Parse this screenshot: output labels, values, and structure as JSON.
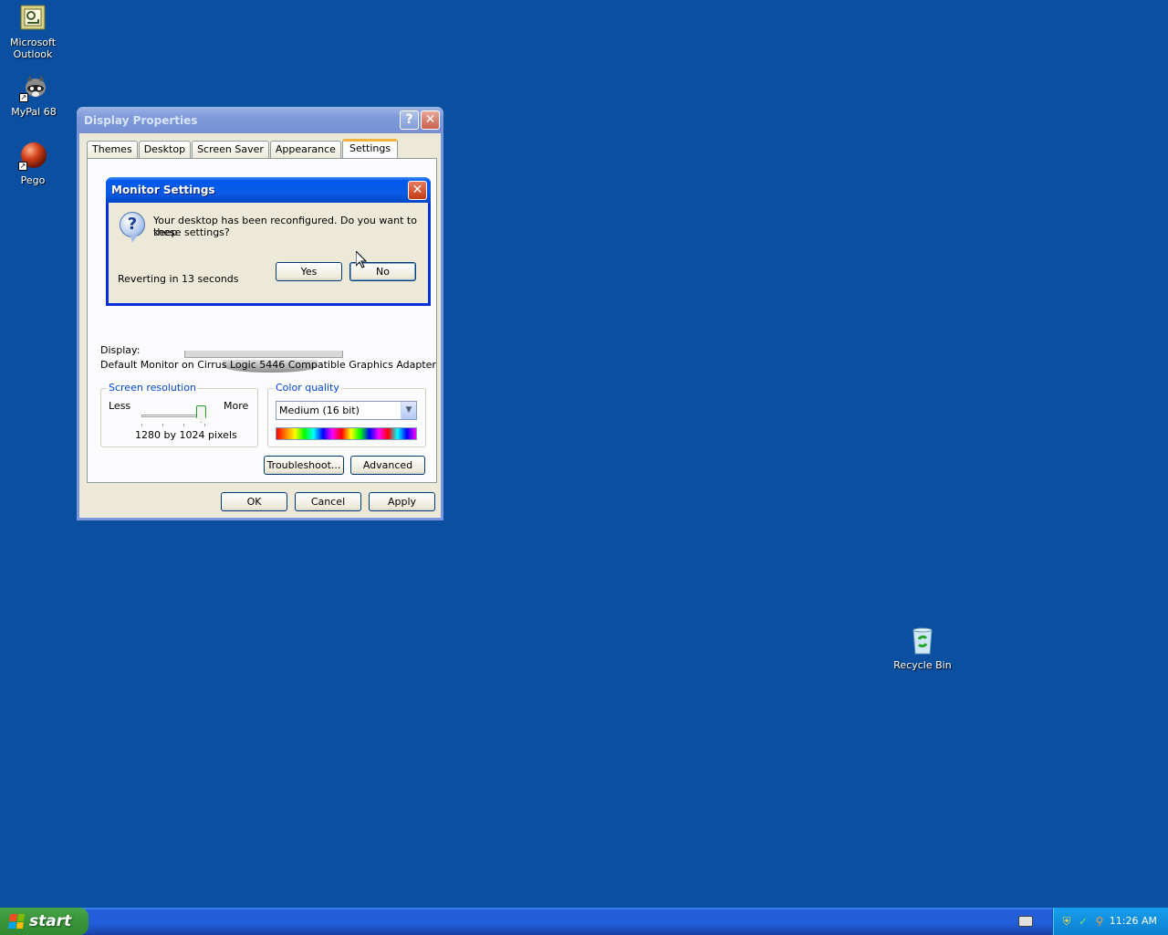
{
  "desktop": {
    "icons": [
      {
        "label_line1": "Microsoft",
        "label_line2": "Outlook"
      },
      {
        "label_line1": "MyPal 68",
        "label_line2": ""
      },
      {
        "label_line1": "Pego",
        "label_line2": ""
      },
      {
        "label_line1": "Recycle Bin",
        "label_line2": ""
      }
    ]
  },
  "display_properties": {
    "title": "Display Properties",
    "help_glyph": "?",
    "close_glyph": "✕",
    "tabs": [
      "Themes",
      "Desktop",
      "Screen Saver",
      "Appearance",
      "Settings"
    ],
    "active_tab": "Settings",
    "display_label": "Display:",
    "display_value": "Default Monitor on Cirrus Logic 5446 Compatible Graphics Adapter",
    "screen_resolution": {
      "legend": "Screen resolution",
      "less": "Less",
      "more": "More",
      "value_text": "1280 by 1024 pixels",
      "slider_level": 1.0
    },
    "color_quality": {
      "legend": "Color quality",
      "selected": "Medium (16 bit)"
    },
    "buttons": {
      "troubleshoot": "Troubleshoot...",
      "advanced": "Advanced",
      "ok": "OK",
      "cancel": "Cancel",
      "apply": "Apply"
    }
  },
  "monitor_settings": {
    "title": "Monitor Settings",
    "close_glyph": "✕",
    "message_line1": "Your desktop has been reconfigured.  Do you want to keep",
    "message_line2": "these settings?",
    "countdown": "Reverting in 13 seconds",
    "yes": "Yes",
    "no": "No"
  },
  "taskbar": {
    "start_label": "start",
    "clock": "11:26 AM"
  },
  "colors": {
    "desktop": "#0a4fa0",
    "titlebar_active": "#0058ee",
    "titlebar_inactive": "#7f9ad9",
    "taskbar": "#245edb",
    "start_button": "#3b963c"
  }
}
